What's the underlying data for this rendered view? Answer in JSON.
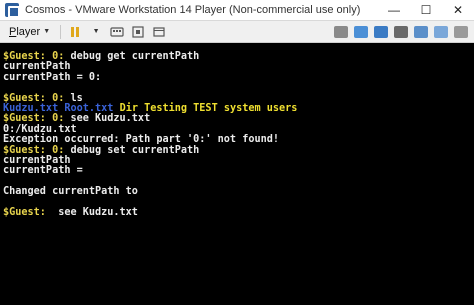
{
  "window": {
    "title": "Cosmos - VMware Workstation 14 Player (Non-commercial use only)",
    "minimize": "—",
    "maximize": "☐",
    "close": "✕"
  },
  "toolbar": {
    "player_menu_prefix": "P",
    "player_menu_rest": "layer"
  },
  "console": {
    "prompt": "$Guest: 0: ",
    "lines": [
      {
        "prompt": "$Guest: 0: ",
        "text": "debug get currentPath"
      },
      {
        "text": "currentPath"
      },
      {
        "text": "currentPath = 0:"
      },
      {
        "text": ""
      },
      {
        "prompt": "$Guest: 0: ",
        "text": "ls"
      },
      {
        "files": [
          "Kudzu.txt",
          "Root.txt"
        ],
        "dirs": "Dir Testing TEST system users"
      },
      {
        "prompt": "$Guest: 0: ",
        "text": "see Kudzu.txt"
      },
      {
        "text": "0:/Kudzu.txt"
      },
      {
        "text": "Exception occurred: Path part '0:' not found!"
      },
      {
        "prompt": "$Guest: 0: ",
        "text": "debug set currentPath"
      },
      {
        "text": "currentPath"
      },
      {
        "text": "currentPath ="
      },
      {
        "text": ""
      },
      {
        "text": "Changed currentPath to"
      },
      {
        "text": ""
      },
      {
        "prompt": "$Guest: ",
        "text": " see Kudzu.txt"
      }
    ]
  },
  "colors": {
    "prompt": "#e8d44d",
    "text": "#ececec",
    "file": "#3a63d8",
    "dir": "#f0e030"
  }
}
